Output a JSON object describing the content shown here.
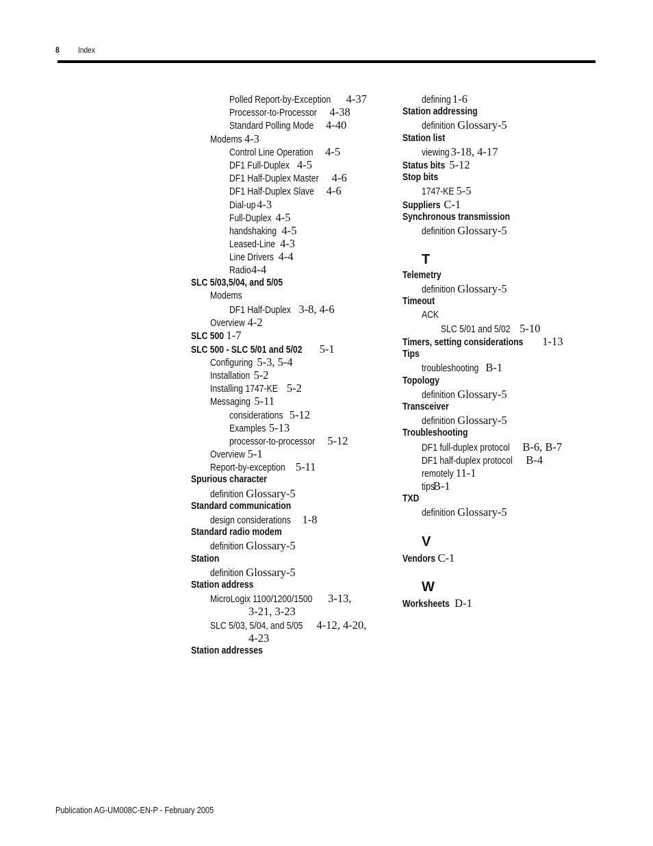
{
  "header": {
    "page_number": "8",
    "section_title": "Index"
  },
  "footer": {
    "publication": "Publication AG-UM008C-EN-P - February 2005"
  },
  "left_column": [
    {
      "level": 2,
      "term": "Polled Report-by-Exception",
      "pages": "4-37"
    },
    {
      "level": 2,
      "term": "Processor-to-Processor",
      "pages": "4-38"
    },
    {
      "level": 2,
      "term": "Standard Polling Mode",
      "pages": "4-40"
    },
    {
      "level": 1,
      "term": "Modems",
      "pages": "4-3"
    },
    {
      "level": 2,
      "term": "Control Line Operation",
      "pages": "4-5"
    },
    {
      "level": 2,
      "term": "DF1 Full-Duplex",
      "pages": "4-5"
    },
    {
      "level": 2,
      "term": "DF1 Half-Duplex Master",
      "pages": "4-6"
    },
    {
      "level": 2,
      "term": "DF1 Half-Duplex Slave",
      "pages": "4-6"
    },
    {
      "level": 2,
      "term": "Dial-up",
      "pages": "4-3"
    },
    {
      "level": 2,
      "term": "Full-Duplex",
      "pages": "4-5"
    },
    {
      "level": 2,
      "term": "handshaking",
      "pages": "4-5"
    },
    {
      "level": 2,
      "term": "Leased-Line",
      "pages": "4-3"
    },
    {
      "level": 2,
      "term": "Line Drivers",
      "pages": "4-4"
    },
    {
      "level": 2,
      "term": "Radio",
      "pages": "4-4"
    },
    {
      "level": 0,
      "term": "SLC 5/03,5/04, and 5/05",
      "pages": ""
    },
    {
      "level": 1,
      "term": "Modems",
      "pages": ""
    },
    {
      "level": 2,
      "term": "DF1 Half-Duplex",
      "pages": "3-8, 4-6"
    },
    {
      "level": 1,
      "term": "Overview",
      "pages": "4-2"
    },
    {
      "level": 0,
      "term": "SLC 500",
      "pages": "1-7"
    },
    {
      "level": 0,
      "term": "SLC 500 - SLC 5/01 and 5/02",
      "pages": "5-1"
    },
    {
      "level": 1,
      "term": "Configuring",
      "pages": "5-3, 5-4"
    },
    {
      "level": 1,
      "term": "Installation",
      "pages": "5-2"
    },
    {
      "level": 1,
      "term": "Installing 1747-KE",
      "pages": "5-2"
    },
    {
      "level": 1,
      "term": "Messaging",
      "pages": "5-11"
    },
    {
      "level": 2,
      "term": "considerations",
      "pages": "5-12"
    },
    {
      "level": 2,
      "term": "Examples",
      "pages": "5-13"
    },
    {
      "level": 2,
      "term": "processor-to-processor",
      "pages": "5-12"
    },
    {
      "level": 1,
      "term": "Overview",
      "pages": "5-1"
    },
    {
      "level": 1,
      "term": "Report-by-exception",
      "pages": "5-11"
    },
    {
      "level": 0,
      "term": "Spurious character",
      "pages": ""
    },
    {
      "level": 1,
      "term": "definition",
      "pages": "Glossary-5"
    },
    {
      "level": 0,
      "term": "Standard communication",
      "pages": ""
    },
    {
      "level": 1,
      "term": "design considerations",
      "pages": "1-8"
    },
    {
      "level": 0,
      "term": "Standard radio modem",
      "pages": ""
    },
    {
      "level": 1,
      "term": "definition",
      "pages": "Glossary-5"
    },
    {
      "level": 0,
      "term": "Station",
      "pages": ""
    },
    {
      "level": 1,
      "term": "definition",
      "pages": "Glossary-5"
    },
    {
      "level": 0,
      "term": "Station address",
      "pages": ""
    },
    {
      "level": 1,
      "term": "MicroLogix 1100/1200/1500",
      "pages": "3-13,"
    },
    {
      "level": 3,
      "term": "",
      "pages": "3-21, 3-23"
    },
    {
      "level": 1,
      "term": "SLC 5/03, 5/04, and 5/05",
      "pages": "4-12, 4-20,"
    },
    {
      "level": 3,
      "term": "",
      "pages": "4-23"
    },
    {
      "level": 0,
      "term": "Station addresses",
      "pages": ""
    }
  ],
  "right_column": [
    {
      "type": "entry",
      "level": 1,
      "term": "defining",
      "pages": "1-6"
    },
    {
      "type": "entry",
      "level": 0,
      "term": "Station addressing",
      "pages": ""
    },
    {
      "type": "entry",
      "level": 1,
      "term": "definition",
      "pages": "Glossary-5"
    },
    {
      "type": "entry",
      "level": 0,
      "term": "Station list",
      "pages": ""
    },
    {
      "type": "entry",
      "level": 1,
      "term": "viewing",
      "pages": "3-18, 4-17"
    },
    {
      "type": "entry",
      "level": 0,
      "term": "Status bits",
      "pages": "5-12"
    },
    {
      "type": "entry",
      "level": 0,
      "term": "Stop bits",
      "pages": ""
    },
    {
      "type": "entry",
      "level": 1,
      "term": "1747-KE",
      "pages": "5-5"
    },
    {
      "type": "entry",
      "level": 0,
      "term": "Suppliers",
      "pages": "C-1"
    },
    {
      "type": "entry",
      "level": 0,
      "term": "Synchronous transmission",
      "pages": ""
    },
    {
      "type": "entry",
      "level": 1,
      "term": "definition",
      "pages": "Glossary-5"
    },
    {
      "type": "letter",
      "letter": "T"
    },
    {
      "type": "entry",
      "level": 0,
      "term": "Telemetry",
      "pages": ""
    },
    {
      "type": "entry",
      "level": 1,
      "term": "definition",
      "pages": "Glossary-5"
    },
    {
      "type": "entry",
      "level": 0,
      "term": "Timeout",
      "pages": ""
    },
    {
      "type": "entry",
      "level": 1,
      "term": "ACK",
      "pages": ""
    },
    {
      "type": "entry",
      "level": 2,
      "term": "SLC 5/01 and 5/02",
      "pages": "5-10"
    },
    {
      "type": "entry",
      "level": 0,
      "term": "Timers, setting considerations",
      "pages": "1-13"
    },
    {
      "type": "entry",
      "level": 0,
      "term": "Tips",
      "pages": ""
    },
    {
      "type": "entry",
      "level": 1,
      "term": "troubleshooting",
      "pages": "B-1"
    },
    {
      "type": "entry",
      "level": 0,
      "term": "Topology",
      "pages": ""
    },
    {
      "type": "entry",
      "level": 1,
      "term": "definition",
      "pages": "Glossary-5"
    },
    {
      "type": "entry",
      "level": 0,
      "term": "Transceiver",
      "pages": ""
    },
    {
      "type": "entry",
      "level": 1,
      "term": "definition",
      "pages": "Glossary-5"
    },
    {
      "type": "entry",
      "level": 0,
      "term": "Troubleshooting",
      "pages": ""
    },
    {
      "type": "entry",
      "level": 1,
      "term": "DF1 full-duplex protocol",
      "pages": "B-6, B-7"
    },
    {
      "type": "entry",
      "level": 1,
      "term": "DF1 half-duplex protocol",
      "pages": "B-4"
    },
    {
      "type": "entry",
      "level": 1,
      "term": "remotely",
      "pages": "11-1"
    },
    {
      "type": "entry",
      "level": 1,
      "term": "tips",
      "pages": "B-1"
    },
    {
      "type": "entry",
      "level": 0,
      "term": "TXD",
      "pages": ""
    },
    {
      "type": "entry",
      "level": 1,
      "term": "definition",
      "pages": "Glossary-5"
    },
    {
      "type": "letter",
      "letter": "V"
    },
    {
      "type": "entry",
      "level": 0,
      "term": "Vendors",
      "pages": "C-1"
    },
    {
      "type": "letter",
      "letter": "W"
    },
    {
      "type": "entry",
      "level": 0,
      "term": "Worksheets",
      "pages": "D-1"
    }
  ]
}
